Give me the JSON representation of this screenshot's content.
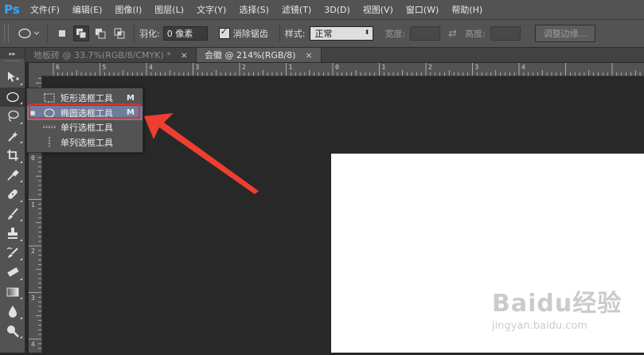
{
  "app": {
    "logo": "Ps"
  },
  "menu": [
    "文件(F)",
    "编辑(E)",
    "图像(I)",
    "图层(L)",
    "文字(Y)",
    "选择(S)",
    "滤镜(T)",
    "3D(D)",
    "视图(V)",
    "窗口(W)",
    "帮助(H)"
  ],
  "options": {
    "feather_label": "羽化:",
    "feather_value": "0 像素",
    "antialias_label": "消除锯齿",
    "style_label": "样式:",
    "style_value": "正常",
    "width_label": "宽度:",
    "height_label": "高度:",
    "refine_label": "调整边缘..."
  },
  "tabs": [
    {
      "label": "地板砖 @ 33.7%(RGB/8/CMYK) *",
      "close": "×"
    },
    {
      "label": "会徽 @ 214%(RGB/8)",
      "close": "×"
    }
  ],
  "ruler": {
    "h_labels": [
      "6",
      "5",
      "4",
      "3",
      "2",
      "1",
      "0",
      "1",
      "2",
      "3",
      "4"
    ],
    "v_labels": [
      "0",
      "1",
      "2",
      "3",
      "4"
    ]
  },
  "flyout": {
    "items": [
      {
        "label": "矩形选框工具",
        "key": "M",
        "icon": "rect-marquee-icon"
      },
      {
        "label": "椭圆选框工具",
        "key": "M",
        "icon": "ellipse-marquee-icon"
      },
      {
        "label": "单行选框工具",
        "key": "",
        "icon": "single-row-marquee-icon"
      },
      {
        "label": "单列选框工具",
        "key": "",
        "icon": "single-column-marquee-icon"
      }
    ],
    "selected_index": 1
  },
  "watermark": {
    "brand": "Baidu经验",
    "url": "jingyan.baidu.com"
  },
  "colors": {
    "highlight": "#d9342b",
    "ps_blue": "#31a8ff",
    "selected_row": "#6e7d9c"
  }
}
